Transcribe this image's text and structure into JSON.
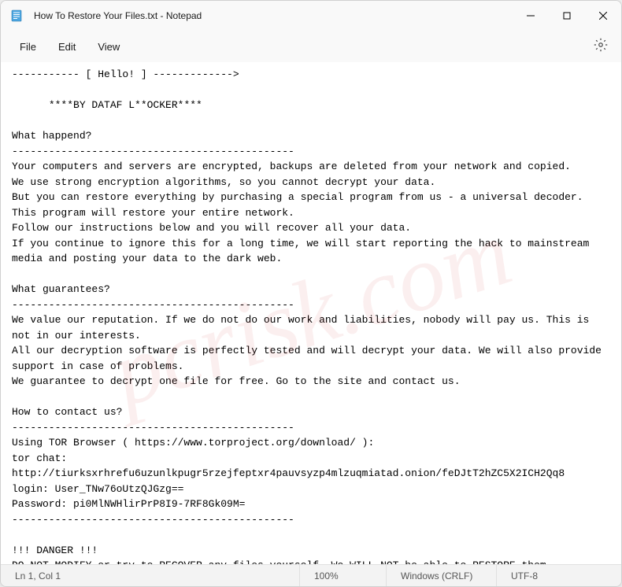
{
  "titlebar": {
    "title": "How To Restore Your Files.txt - Notepad"
  },
  "menubar": {
    "items": [
      "File",
      "Edit",
      "View"
    ],
    "settings_icon": "gear-icon"
  },
  "content": {
    "text": "----------- [ Hello! ] ------------->\n\n      ****BY DATAF L**OCKER****\n\nWhat happend?\n----------------------------------------------\nYour computers and servers are encrypted, backups are deleted from your network and copied.\nWe use strong encryption algorithms, so you cannot decrypt your data.\nBut you can restore everything by purchasing a special program from us - a universal decoder. This program will restore your entire network.\nFollow our instructions below and you will recover all your data.\nIf you continue to ignore this for a long time, we will start reporting the hack to mainstream media and posting your data to the dark web.\n\nWhat guarantees?\n----------------------------------------------\nWe value our reputation. If we do not do our work and liabilities, nobody will pay us. This is not in our interests.\nAll our decryption software is perfectly tested and will decrypt your data. We will also provide support in case of problems.\nWe guarantee to decrypt one file for free. Go to the site and contact us.\n\nHow to contact us?\n----------------------------------------------\nUsing TOR Browser ( https://www.torproject.org/download/ ):\ntor chat:\nhttp://tiurksxrhrefu6uzunlkpugr5rzejfeptxr4pauvsyzp4mlzuqmiatad.onion/feDJtT2hZC5X2ICH2Qq8\nlogin: User_TNw76oUtzQJGzg==\nPassword: pi0MlNWHlirPrP8I9-7RF8Gk09M=\n----------------------------------------------\n\n!!! DANGER !!!\nDO NOT MODIFY or try to RECOVER any files yourself. We WILL NOT be able to RESTORE them.\n!!! DANGER !!"
  },
  "statusbar": {
    "position": "Ln 1, Col 1",
    "zoom": "100%",
    "line_ending": "Windows (CRLF)",
    "encoding": "UTF-8"
  },
  "watermark": "pcrisk.com"
}
